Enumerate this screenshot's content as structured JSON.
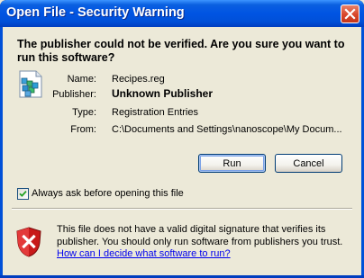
{
  "window": {
    "title": "Open File - Security Warning"
  },
  "dialog": {
    "heading": "The publisher could not be verified.  Are you sure you want to run this software?",
    "fields": [
      {
        "label": "Name:",
        "value": "Recipes.reg"
      },
      {
        "label": "Publisher:",
        "value": "Unknown Publisher"
      },
      {
        "label": "Type:",
        "value": "Registration Entries"
      },
      {
        "label": "From:",
        "value": "C:\\Documents and Settings\\nanoscope\\My Docum..."
      }
    ],
    "buttons": {
      "run": "Run",
      "cancel": "Cancel"
    },
    "checkbox": {
      "label": "Always ask before opening this file",
      "checked": true
    },
    "warning": {
      "text": "This file does not have a valid digital signature that verifies its publisher.  You should only run software from publishers you trust.",
      "link": "How can I decide what software to run?"
    }
  },
  "icons": {
    "close": "close-icon",
    "file": "registry-file-icon",
    "shield": "security-shield-icon",
    "checkmark": "checkmark-icon"
  },
  "colors": {
    "titlebar": "#0054e3",
    "close_button": "#d8462a",
    "dialog_bg": "#ece9d8",
    "link": "#0000ee"
  }
}
